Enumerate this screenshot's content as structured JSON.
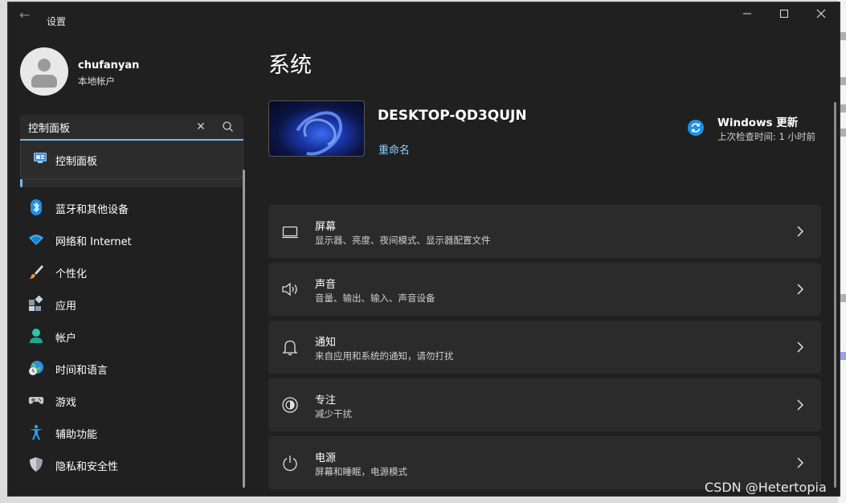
{
  "window": {
    "title": "设置",
    "back_glyph": "←",
    "minimize_glyph": "—",
    "maximize_glyph": "☐",
    "close_glyph": "✕"
  },
  "account": {
    "name": "chufanyan",
    "type": "本地帐户"
  },
  "search": {
    "value": "控制面板",
    "clear_glyph": "✕",
    "suggestion": "控制面板"
  },
  "sidebar": {
    "items": [
      {
        "label": "蓝牙和其他设备",
        "icon": "bluetooth-icon"
      },
      {
        "label": "网络和 Internet",
        "icon": "wifi-icon"
      },
      {
        "label": "个性化",
        "icon": "brush-icon"
      },
      {
        "label": "应用",
        "icon": "apps-icon"
      },
      {
        "label": "帐户",
        "icon": "person-icon"
      },
      {
        "label": "时间和语言",
        "icon": "globe-clock-icon"
      },
      {
        "label": "游戏",
        "icon": "gamepad-icon"
      },
      {
        "label": "辅助功能",
        "icon": "accessibility-icon"
      },
      {
        "label": "隐私和安全性",
        "icon": "shield-icon"
      }
    ]
  },
  "main": {
    "title": "系统",
    "device_name": "DESKTOP-QD3QUJN",
    "rename_label": "重命名",
    "update": {
      "title": "Windows 更新",
      "subtitle": "上次检查时间: 1 小时前"
    },
    "cards": [
      {
        "title": "屏幕",
        "subtitle": "显示器、亮度、夜间模式、显示器配置文件",
        "icon": "monitor-icon"
      },
      {
        "title": "声音",
        "subtitle": "音量、输出、输入、声音设备",
        "icon": "speaker-icon"
      },
      {
        "title": "通知",
        "subtitle": "来自应用和系统的通知，请勿打扰",
        "icon": "bell-icon"
      },
      {
        "title": "专注",
        "subtitle": "减少干扰",
        "icon": "focus-icon"
      },
      {
        "title": "电源",
        "subtitle": "屏幕和睡眠，电源模式",
        "icon": "power-icon"
      }
    ]
  },
  "watermark": "CSDN @Hetertopia",
  "colors": {
    "window_bg": "#202020",
    "card_bg": "#2b2b2b",
    "accent": "#76b9ed",
    "link": "#8fd1ff",
    "update_blue": "#1e90e6"
  }
}
